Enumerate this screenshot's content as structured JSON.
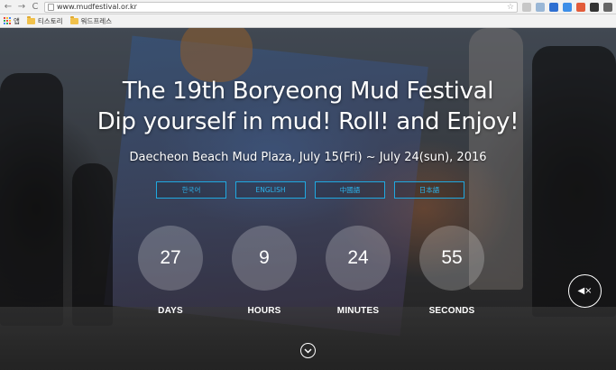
{
  "browser": {
    "url": "www.mudfestival.or.kr",
    "back_glyph": "←",
    "forward_glyph": "→",
    "reload_glyph": "C",
    "star_glyph": "☆"
  },
  "bookmarks": {
    "apps_label": "앱",
    "items": [
      {
        "label": "티스토리",
        "icon": "folder-icon"
      },
      {
        "label": "워드프레스",
        "icon": "folder-icon"
      }
    ]
  },
  "hero": {
    "title_line1": "The 19th Boryeong Mud Festival",
    "title_line2": "Dip yourself in mud! Roll! and Enjoy!",
    "subtitle": "Daecheon Beach Mud Plaza, July 15(Fri) ~ July 24(sun), 2016"
  },
  "languages": [
    {
      "label": "한국어"
    },
    {
      "label": "ENGLISH"
    },
    {
      "label": "中國語"
    },
    {
      "label": "日本語"
    }
  ],
  "countdown": [
    {
      "value": "27",
      "label": "DAYS"
    },
    {
      "value": "9",
      "label": "HOURS"
    },
    {
      "value": "24",
      "label": "MINUTES"
    },
    {
      "value": "55",
      "label": "SECONDS"
    }
  ],
  "controls": {
    "mute_glyph": "◀×",
    "scroll_glyph": "⌄"
  },
  "colors": {
    "language_accent": "#2bb5ee",
    "countdown_circle": "rgba(255,255,255,0.22)"
  }
}
